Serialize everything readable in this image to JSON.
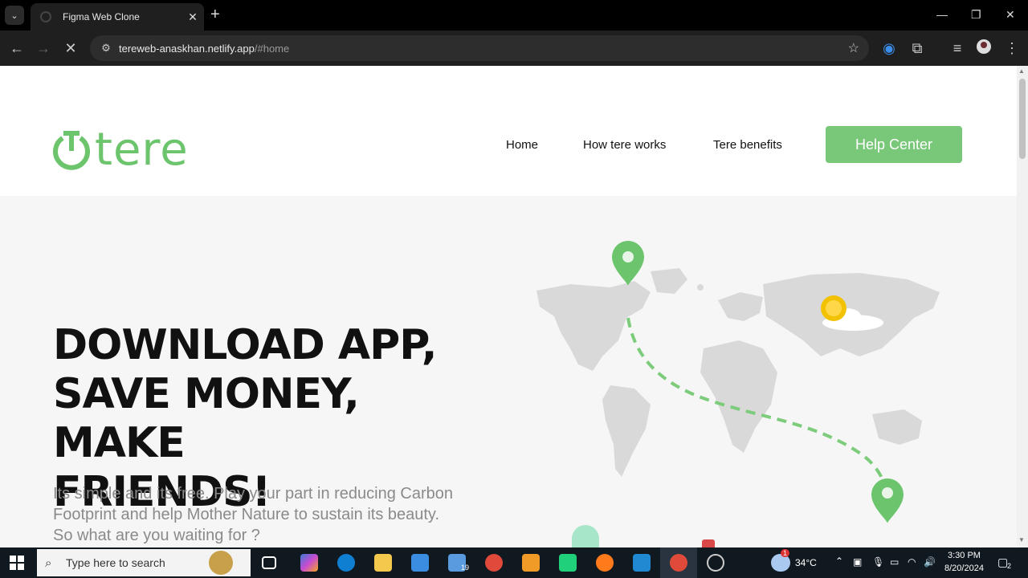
{
  "browser": {
    "tab_title": "Figma Web Clone",
    "url_host": "tereweb-anaskhan.netlify.app",
    "url_path": "/#home"
  },
  "site": {
    "logo_text": "tere",
    "nav": [
      "Home",
      "How tere works",
      "Tere benefits"
    ],
    "help_button": "Help Center",
    "hero_title_lines": [
      "DOWNLOAD APP,",
      "SAVE MONEY, MAKE",
      "FRIENDS!"
    ],
    "hero_subtitle": "Its simple and its free. Play your part in reducing Carbon Footprint and help Mother Nature to sustain its beauty. So what are you waiting for ?",
    "accent_color": "#79c779"
  },
  "taskbar": {
    "search_placeholder": "Type here to search",
    "mail_badge": "19",
    "weather_badge": "1",
    "temperature": "34°C",
    "time": "3:30 PM",
    "date": "8/20/2024",
    "notification_count": "2"
  }
}
